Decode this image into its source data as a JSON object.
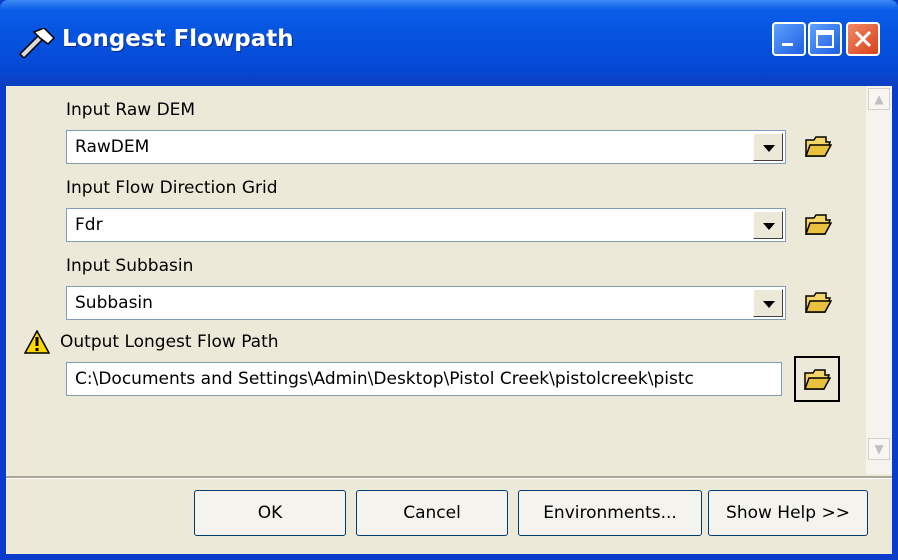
{
  "window": {
    "title": "Longest Flowpath"
  },
  "fields": [
    {
      "label": "Input Raw DEM",
      "value": "RawDEM"
    },
    {
      "label": "Input Flow Direction Grid",
      "value": "Fdr"
    },
    {
      "label": "Input Subbasin",
      "value": "Subbasin"
    },
    {
      "label": "Output Longest Flow Path",
      "value": "C:\\Documents and Settings\\Admin\\Desktop\\Pistol Creek\\pistolcreek\\pistc"
    }
  ],
  "buttons": {
    "ok": "OK",
    "cancel": "Cancel",
    "environments": "Environments...",
    "show_help": "Show Help >>"
  },
  "icons": {
    "title": "hammer-icon",
    "browse": "open-folder-icon",
    "warning": "warning-icon",
    "minimize": "minimize-icon",
    "maximize": "maximize-icon",
    "close": "close-icon"
  },
  "colors": {
    "titlebar": "#0553de",
    "dialog_bg": "#ece9d8",
    "close_button": "#d6401a"
  }
}
